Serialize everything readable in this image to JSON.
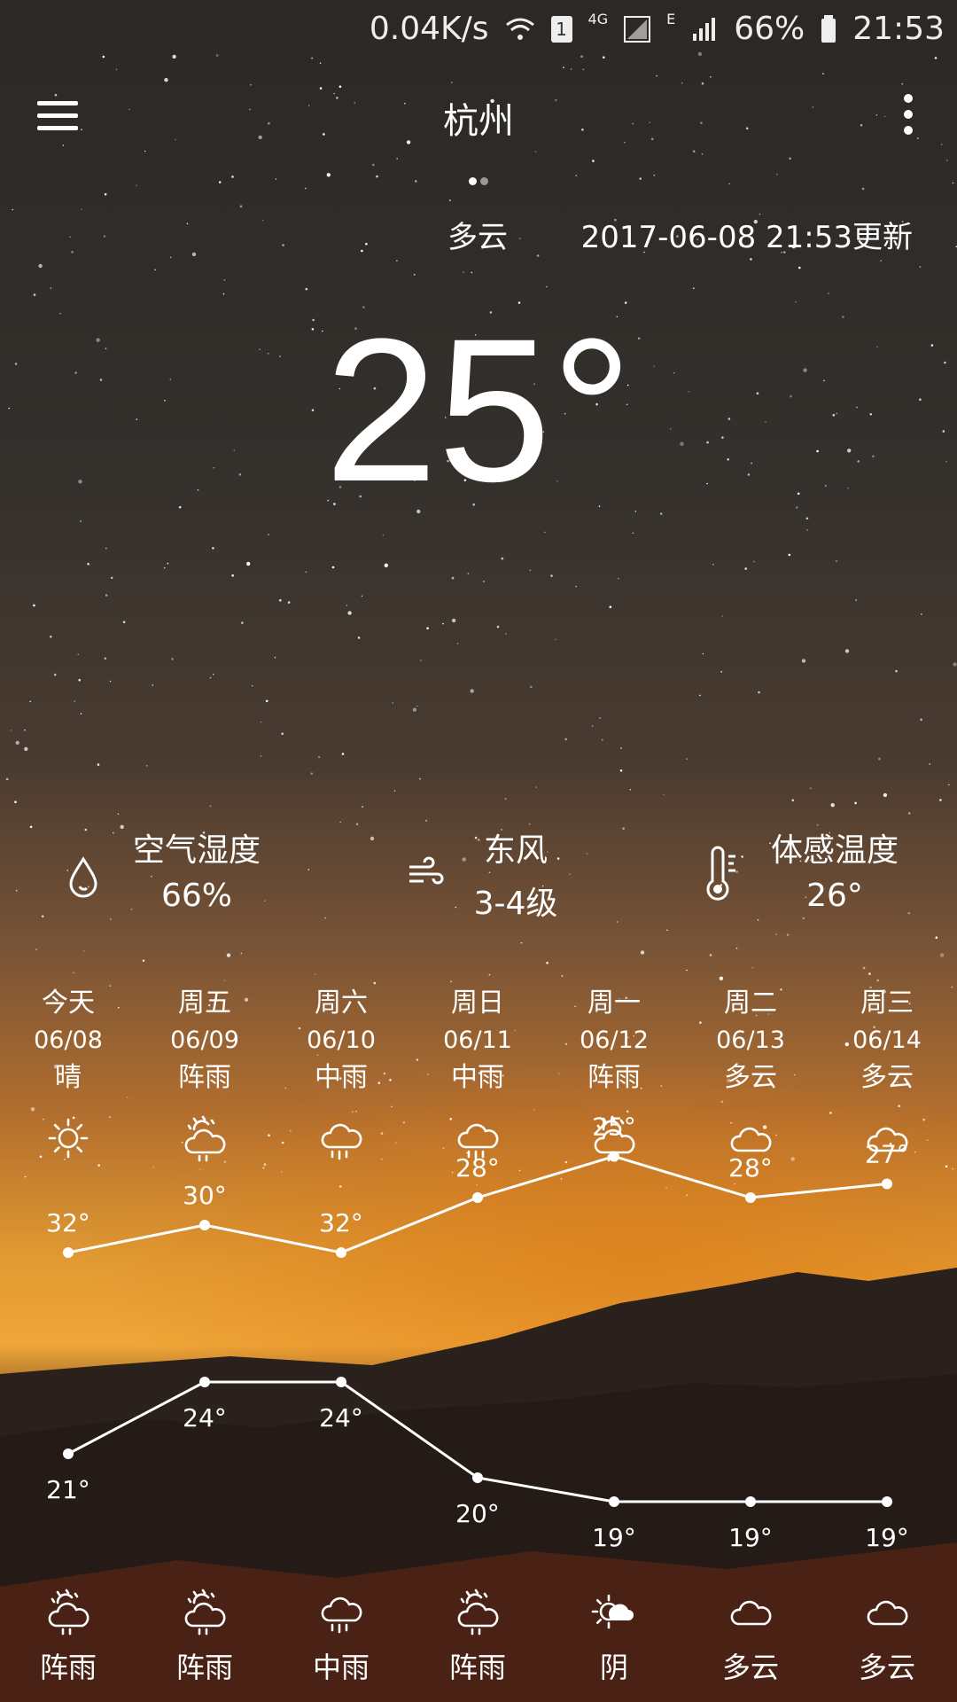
{
  "status_bar": {
    "net_speed": "0.04K/s",
    "sim_badge": "1",
    "net_type": "4G",
    "net_type2": "E",
    "battery": "66%",
    "time": "21:53"
  },
  "header": {
    "city": "杭州",
    "page_dots": 2,
    "menu_icon": "hamburger-menu-icon",
    "more_icon": "vertical-dots-icon"
  },
  "current": {
    "condition": "多云",
    "updated": "2017-06-08 21:53更新",
    "temperature": "25°"
  },
  "details": [
    {
      "label": "空气湿度",
      "value": "66%",
      "icon": "droplet-icon"
    },
    {
      "label": "东风",
      "value": "3-4级",
      "icon": "wind-icon"
    },
    {
      "label": "体感温度",
      "value": "26°",
      "icon": "thermometer-icon"
    }
  ],
  "forecast": [
    {
      "day": "今天",
      "date": "06/08",
      "day_cond": "晴",
      "day_icon": "sun",
      "high": 32,
      "high_label": "32°",
      "low": 21,
      "low_label": "21°",
      "night_cond": "阵雨",
      "night_icon": "shower"
    },
    {
      "day": "周五",
      "date": "06/09",
      "day_cond": "阵雨",
      "day_icon": "shower",
      "high": 30,
      "high_label": "30°",
      "low": 24,
      "low_label": "24°",
      "night_cond": "阵雨",
      "night_icon": "shower"
    },
    {
      "day": "周六",
      "date": "06/10",
      "day_cond": "中雨",
      "day_icon": "rain",
      "high": 32,
      "high_label": "32°",
      "low": 24,
      "low_label": "24°",
      "night_cond": "中雨",
      "night_icon": "rain"
    },
    {
      "day": "周日",
      "date": "06/11",
      "day_cond": "中雨",
      "day_icon": "rain",
      "high": 28,
      "high_label": "28°",
      "low": 20,
      "low_label": "20°",
      "night_cond": "阵雨",
      "night_icon": "shower"
    },
    {
      "day": "周一",
      "date": "06/12",
      "day_cond": "阵雨",
      "day_icon": "shower",
      "high": 25,
      "high_label": "25°",
      "low": 19,
      "low_label": "19°",
      "night_cond": "阴",
      "night_icon": "overcast"
    },
    {
      "day": "周二",
      "date": "06/13",
      "day_cond": "多云",
      "day_icon": "cloud",
      "high": 28,
      "high_label": "28°",
      "low": 19,
      "low_label": "19°",
      "night_cond": "多云",
      "night_icon": "cloud"
    },
    {
      "day": "周三",
      "date": "06/14",
      "day_cond": "多云",
      "day_icon": "cloud",
      "high": 27,
      "high_label": "27°",
      "low": 19,
      "low_label": "19°",
      "night_cond": "多云",
      "night_icon": "cloud"
    }
  ],
  "chart_data": {
    "type": "line",
    "categories": [
      "06/08",
      "06/09",
      "06/10",
      "06/11",
      "06/12",
      "06/13",
      "06/14"
    ],
    "series": [
      {
        "values": [
          32,
          30,
          32,
          28,
          25,
          28,
          27
        ]
      },
      {
        "values": [
          21,
          24,
          24,
          20,
          19,
          19,
          19
        ]
      }
    ],
    "title": "",
    "xlabel": "",
    "ylabel": ""
  },
  "colors": {
    "text": "#ffffff",
    "line": "#ffffff",
    "sky_top": "#2b2826",
    "horizon": "#f0a638",
    "ground": "#241b17"
  }
}
